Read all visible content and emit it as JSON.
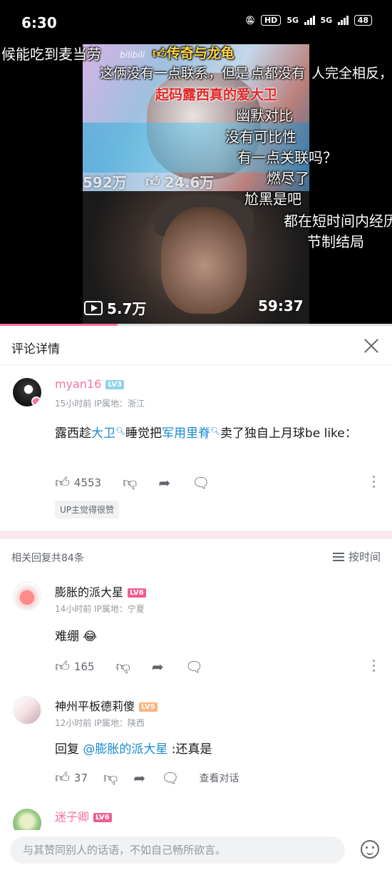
{
  "status_bar": {
    "time": "6:30",
    "hd": "HD",
    "net1": "5G",
    "net2": "5G",
    "battery": "48"
  },
  "video": {
    "bili_watermark": "bilibili",
    "top_stats": {
      "views": "592万",
      "likes": "24.6万"
    },
    "bottom_stats": {
      "views": "5.7万",
      "duration": "59:37"
    },
    "progress_fraction": 0.3,
    "danmaku": {
      "d1": "候能吃到麦当劳",
      "d2": "传奇与龙龟",
      "d3": "这俩没有一点联系，但是",
      "d4": "点都没有",
      "d5": "人完全相反，",
      "d6": "起码露西真的爱大卫",
      "d7": "幽默对比",
      "d8": "没有可比性",
      "d9": "有一点关联吗？",
      "d10": "燃尽了",
      "d11": "尬黑是吧",
      "d12": "都在短时间内经历",
      "d13": "节制结局"
    }
  },
  "sheet": {
    "title": "评论详情"
  },
  "main_comment": {
    "username": "myan16",
    "level": "LV3",
    "meta": "15小时前  IP属地：浙江",
    "text_1": "露西趁",
    "link_1": "大卫",
    "text_2": "睡觉把",
    "link_2": "军用里脊",
    "text_3": "卖了独自上月球be like：",
    "likes": "4553",
    "badge": "UP主觉得很赞"
  },
  "replies": {
    "count_label": "相关回复共84条",
    "sort_label": "按时间",
    "items": [
      {
        "username": "膨胀的派大星",
        "level": "LV6",
        "meta": "14小时前  IP属地：宁夏",
        "text": "难绷",
        "emoji": "😂",
        "likes": "165"
      },
      {
        "username": "神州平板德莉傻",
        "level": "LV5",
        "meta": "12小时前  IP属地：陕西",
        "reply_prefix": "回复 ",
        "mention": "@膨胀的派大星",
        "text": " :还真是",
        "likes": "37",
        "view_conv": "查看对话"
      },
      {
        "username": "迷子卿",
        "level": "LV6"
      }
    ]
  },
  "input": {
    "placeholder": "与其赞同别人的话语，不如自己畅所欲言。"
  },
  "colors": {
    "accent_pink": "#fb7299",
    "link_blue": "#178bcf",
    "lv3": "#8fd3e8",
    "lv5": "#ffb37c",
    "lv6": "#f25d8e"
  }
}
